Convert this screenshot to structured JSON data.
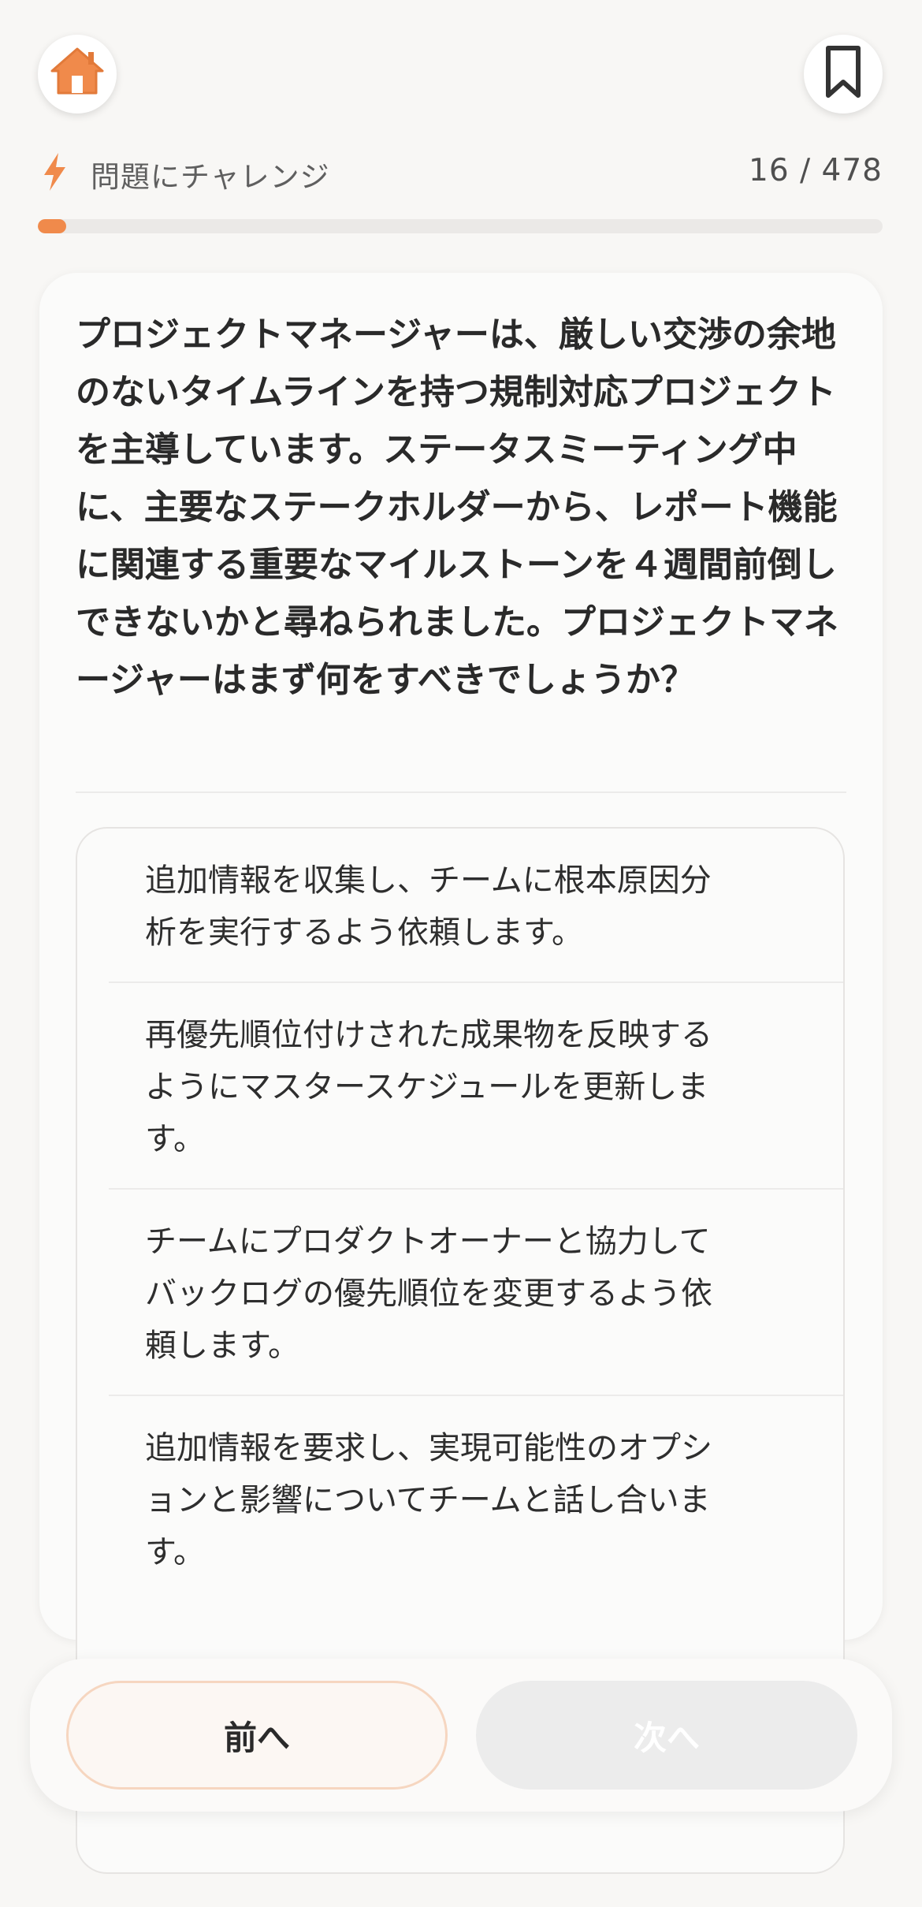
{
  "header": {
    "home_icon": "home-icon",
    "bookmark_icon": "bookmark-icon"
  },
  "progress": {
    "mode_label": "問題にチャレンジ",
    "mode_icon": "lightning-bolt-icon",
    "counter": "16 / 478",
    "current": 16,
    "total": 478,
    "accent_color": "#f08a4b"
  },
  "question": {
    "text": "プロジェクトマネージャーは、厳しい交渉の余地のないタイムラインを持つ規制対応プロジェクトを主導しています。ステータスミーティング中に、主要なステークホルダーから、レポート機能に関連する重要なマイルストーンを４週間前倒しできないかと尋ねられました。プロジェクトマネージャーはまず何をすべきでしょうか？"
  },
  "options": [
    {
      "text": "追加情報を収集し、チームに根本原因分析を実行するよう依頼します。"
    },
    {
      "text": "再優先順位付けされた成果物を反映するようにマスタースケジュールを更新します。"
    },
    {
      "text": "チームにプロダクトオーナーと協力してバックログの優先順位を変更するよう依頼します。"
    },
    {
      "text": "追加情報を要求し、実現可能性のオプションと影響についてチームと話し合います。"
    }
  ],
  "footer": {
    "prev_label": "前へ",
    "next_label": "次へ"
  }
}
